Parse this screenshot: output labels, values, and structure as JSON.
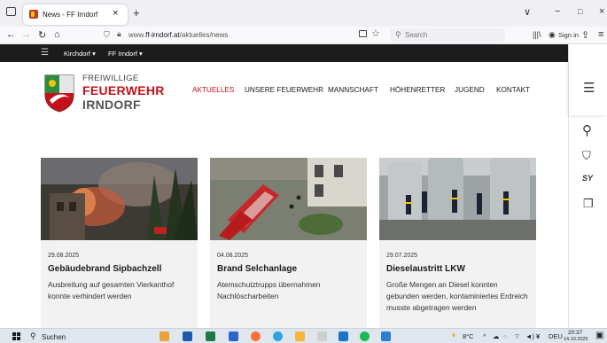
{
  "browser": {
    "tab_title": "News - FF Irndorf",
    "tab_close": "×",
    "new_tab": "+",
    "url_prefix": "www.",
    "url_domain": "ff-irndorf.at",
    "url_path": "/aktuelles/news",
    "search_placeholder": "Search",
    "sign_in": "Sign in",
    "window_controls": [
      "∨",
      "−",
      "□",
      "×"
    ]
  },
  "topbar": {
    "location_1": "Kirchdorf ▾",
    "location_2": "FF Irndorf ▾"
  },
  "logo": {
    "line1": "FREIWILLIGE",
    "line2": "FEUERWEHR",
    "line3": "IRNDORF"
  },
  "nav": [
    "AKTUELLES",
    "UNSERE FEUERWEHR",
    "MANNSCHAFT",
    "HÖHENRETTER",
    "JUGEND",
    "KONTAKT"
  ],
  "articles": [
    {
      "date": "29.08.2025",
      "title": "Gebäudebrand Sipbachzell",
      "text": "Ausbreitung auf gesamten Vierkanthof konnte verhindert werden"
    },
    {
      "date": "04.08.2025",
      "title": "Brand Selchanlage",
      "text": "Atemschutztrupps übernahmen Nachlöscharbeiten"
    },
    {
      "date": "29.07.2025",
      "title": "Dieselaustritt LKW",
      "text": "Große Mengen an Diesel konnten gebunden werden, kontaminiertes Erdreich musste abgetragen werden"
    }
  ],
  "taskbar": {
    "search_placeholder": "Suchen",
    "weather": "8°C",
    "language": "DEU",
    "time": "20:37",
    "date": "14.10.2025"
  },
  "colors": {
    "accent_red": "#c4121a",
    "topbar_bg": "#1c1c1c",
    "card_bg": "#f2f2f2"
  }
}
